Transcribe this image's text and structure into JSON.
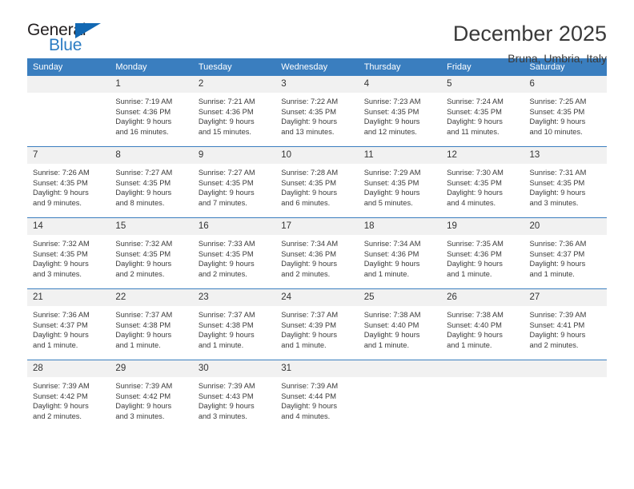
{
  "brand": {
    "name_part1": "General",
    "name_part2": "Blue",
    "triangle_color": "#1268b3",
    "blue_text_color": "#2b7cc3"
  },
  "header": {
    "title": "December 2025",
    "location": "Bruna, Umbria, Italy"
  },
  "theme": {
    "header_bg": "#3a7ebf",
    "header_text": "#ffffff",
    "daynum_bg": "#f1f1f1",
    "row_separator": "#3a7ebf"
  },
  "weekdays": [
    "Sunday",
    "Monday",
    "Tuesday",
    "Wednesday",
    "Thursday",
    "Friday",
    "Saturday"
  ],
  "weeks": [
    [
      {
        "day": "",
        "empty": true,
        "sunrise": "",
        "sunset": "",
        "daylight1": "",
        "daylight2": ""
      },
      {
        "day": "1",
        "empty": false,
        "sunrise": "Sunrise: 7:19 AM",
        "sunset": "Sunset: 4:36 PM",
        "daylight1": "Daylight: 9 hours",
        "daylight2": "and 16 minutes."
      },
      {
        "day": "2",
        "empty": false,
        "sunrise": "Sunrise: 7:21 AM",
        "sunset": "Sunset: 4:36 PM",
        "daylight1": "Daylight: 9 hours",
        "daylight2": "and 15 minutes."
      },
      {
        "day": "3",
        "empty": false,
        "sunrise": "Sunrise: 7:22 AM",
        "sunset": "Sunset: 4:35 PM",
        "daylight1": "Daylight: 9 hours",
        "daylight2": "and 13 minutes."
      },
      {
        "day": "4",
        "empty": false,
        "sunrise": "Sunrise: 7:23 AM",
        "sunset": "Sunset: 4:35 PM",
        "daylight1": "Daylight: 9 hours",
        "daylight2": "and 12 minutes."
      },
      {
        "day": "5",
        "empty": false,
        "sunrise": "Sunrise: 7:24 AM",
        "sunset": "Sunset: 4:35 PM",
        "daylight1": "Daylight: 9 hours",
        "daylight2": "and 11 minutes."
      },
      {
        "day": "6",
        "empty": false,
        "sunrise": "Sunrise: 7:25 AM",
        "sunset": "Sunset: 4:35 PM",
        "daylight1": "Daylight: 9 hours",
        "daylight2": "and 10 minutes."
      }
    ],
    [
      {
        "day": "7",
        "empty": false,
        "sunrise": "Sunrise: 7:26 AM",
        "sunset": "Sunset: 4:35 PM",
        "daylight1": "Daylight: 9 hours",
        "daylight2": "and 9 minutes."
      },
      {
        "day": "8",
        "empty": false,
        "sunrise": "Sunrise: 7:27 AM",
        "sunset": "Sunset: 4:35 PM",
        "daylight1": "Daylight: 9 hours",
        "daylight2": "and 8 minutes."
      },
      {
        "day": "9",
        "empty": false,
        "sunrise": "Sunrise: 7:27 AM",
        "sunset": "Sunset: 4:35 PM",
        "daylight1": "Daylight: 9 hours",
        "daylight2": "and 7 minutes."
      },
      {
        "day": "10",
        "empty": false,
        "sunrise": "Sunrise: 7:28 AM",
        "sunset": "Sunset: 4:35 PM",
        "daylight1": "Daylight: 9 hours",
        "daylight2": "and 6 minutes."
      },
      {
        "day": "11",
        "empty": false,
        "sunrise": "Sunrise: 7:29 AM",
        "sunset": "Sunset: 4:35 PM",
        "daylight1": "Daylight: 9 hours",
        "daylight2": "and 5 minutes."
      },
      {
        "day": "12",
        "empty": false,
        "sunrise": "Sunrise: 7:30 AM",
        "sunset": "Sunset: 4:35 PM",
        "daylight1": "Daylight: 9 hours",
        "daylight2": "and 4 minutes."
      },
      {
        "day": "13",
        "empty": false,
        "sunrise": "Sunrise: 7:31 AM",
        "sunset": "Sunset: 4:35 PM",
        "daylight1": "Daylight: 9 hours",
        "daylight2": "and 3 minutes."
      }
    ],
    [
      {
        "day": "14",
        "empty": false,
        "sunrise": "Sunrise: 7:32 AM",
        "sunset": "Sunset: 4:35 PM",
        "daylight1": "Daylight: 9 hours",
        "daylight2": "and 3 minutes."
      },
      {
        "day": "15",
        "empty": false,
        "sunrise": "Sunrise: 7:32 AM",
        "sunset": "Sunset: 4:35 PM",
        "daylight1": "Daylight: 9 hours",
        "daylight2": "and 2 minutes."
      },
      {
        "day": "16",
        "empty": false,
        "sunrise": "Sunrise: 7:33 AM",
        "sunset": "Sunset: 4:35 PM",
        "daylight1": "Daylight: 9 hours",
        "daylight2": "and 2 minutes."
      },
      {
        "day": "17",
        "empty": false,
        "sunrise": "Sunrise: 7:34 AM",
        "sunset": "Sunset: 4:36 PM",
        "daylight1": "Daylight: 9 hours",
        "daylight2": "and 2 minutes."
      },
      {
        "day": "18",
        "empty": false,
        "sunrise": "Sunrise: 7:34 AM",
        "sunset": "Sunset: 4:36 PM",
        "daylight1": "Daylight: 9 hours",
        "daylight2": "and 1 minute."
      },
      {
        "day": "19",
        "empty": false,
        "sunrise": "Sunrise: 7:35 AM",
        "sunset": "Sunset: 4:36 PM",
        "daylight1": "Daylight: 9 hours",
        "daylight2": "and 1 minute."
      },
      {
        "day": "20",
        "empty": false,
        "sunrise": "Sunrise: 7:36 AM",
        "sunset": "Sunset: 4:37 PM",
        "daylight1": "Daylight: 9 hours",
        "daylight2": "and 1 minute."
      }
    ],
    [
      {
        "day": "21",
        "empty": false,
        "sunrise": "Sunrise: 7:36 AM",
        "sunset": "Sunset: 4:37 PM",
        "daylight1": "Daylight: 9 hours",
        "daylight2": "and 1 minute."
      },
      {
        "day": "22",
        "empty": false,
        "sunrise": "Sunrise: 7:37 AM",
        "sunset": "Sunset: 4:38 PM",
        "daylight1": "Daylight: 9 hours",
        "daylight2": "and 1 minute."
      },
      {
        "day": "23",
        "empty": false,
        "sunrise": "Sunrise: 7:37 AM",
        "sunset": "Sunset: 4:38 PM",
        "daylight1": "Daylight: 9 hours",
        "daylight2": "and 1 minute."
      },
      {
        "day": "24",
        "empty": false,
        "sunrise": "Sunrise: 7:37 AM",
        "sunset": "Sunset: 4:39 PM",
        "daylight1": "Daylight: 9 hours",
        "daylight2": "and 1 minute."
      },
      {
        "day": "25",
        "empty": false,
        "sunrise": "Sunrise: 7:38 AM",
        "sunset": "Sunset: 4:40 PM",
        "daylight1": "Daylight: 9 hours",
        "daylight2": "and 1 minute."
      },
      {
        "day": "26",
        "empty": false,
        "sunrise": "Sunrise: 7:38 AM",
        "sunset": "Sunset: 4:40 PM",
        "daylight1": "Daylight: 9 hours",
        "daylight2": "and 1 minute."
      },
      {
        "day": "27",
        "empty": false,
        "sunrise": "Sunrise: 7:39 AM",
        "sunset": "Sunset: 4:41 PM",
        "daylight1": "Daylight: 9 hours",
        "daylight2": "and 2 minutes."
      }
    ],
    [
      {
        "day": "28",
        "empty": false,
        "sunrise": "Sunrise: 7:39 AM",
        "sunset": "Sunset: 4:42 PM",
        "daylight1": "Daylight: 9 hours",
        "daylight2": "and 2 minutes."
      },
      {
        "day": "29",
        "empty": false,
        "sunrise": "Sunrise: 7:39 AM",
        "sunset": "Sunset: 4:42 PM",
        "daylight1": "Daylight: 9 hours",
        "daylight2": "and 3 minutes."
      },
      {
        "day": "30",
        "empty": false,
        "sunrise": "Sunrise: 7:39 AM",
        "sunset": "Sunset: 4:43 PM",
        "daylight1": "Daylight: 9 hours",
        "daylight2": "and 3 minutes."
      },
      {
        "day": "31",
        "empty": false,
        "sunrise": "Sunrise: 7:39 AM",
        "sunset": "Sunset: 4:44 PM",
        "daylight1": "Daylight: 9 hours",
        "daylight2": "and 4 minutes."
      },
      {
        "day": "",
        "empty": true,
        "sunrise": "",
        "sunset": "",
        "daylight1": "",
        "daylight2": ""
      },
      {
        "day": "",
        "empty": true,
        "sunrise": "",
        "sunset": "",
        "daylight1": "",
        "daylight2": ""
      },
      {
        "day": "",
        "empty": true,
        "sunrise": "",
        "sunset": "",
        "daylight1": "",
        "daylight2": ""
      }
    ]
  ]
}
